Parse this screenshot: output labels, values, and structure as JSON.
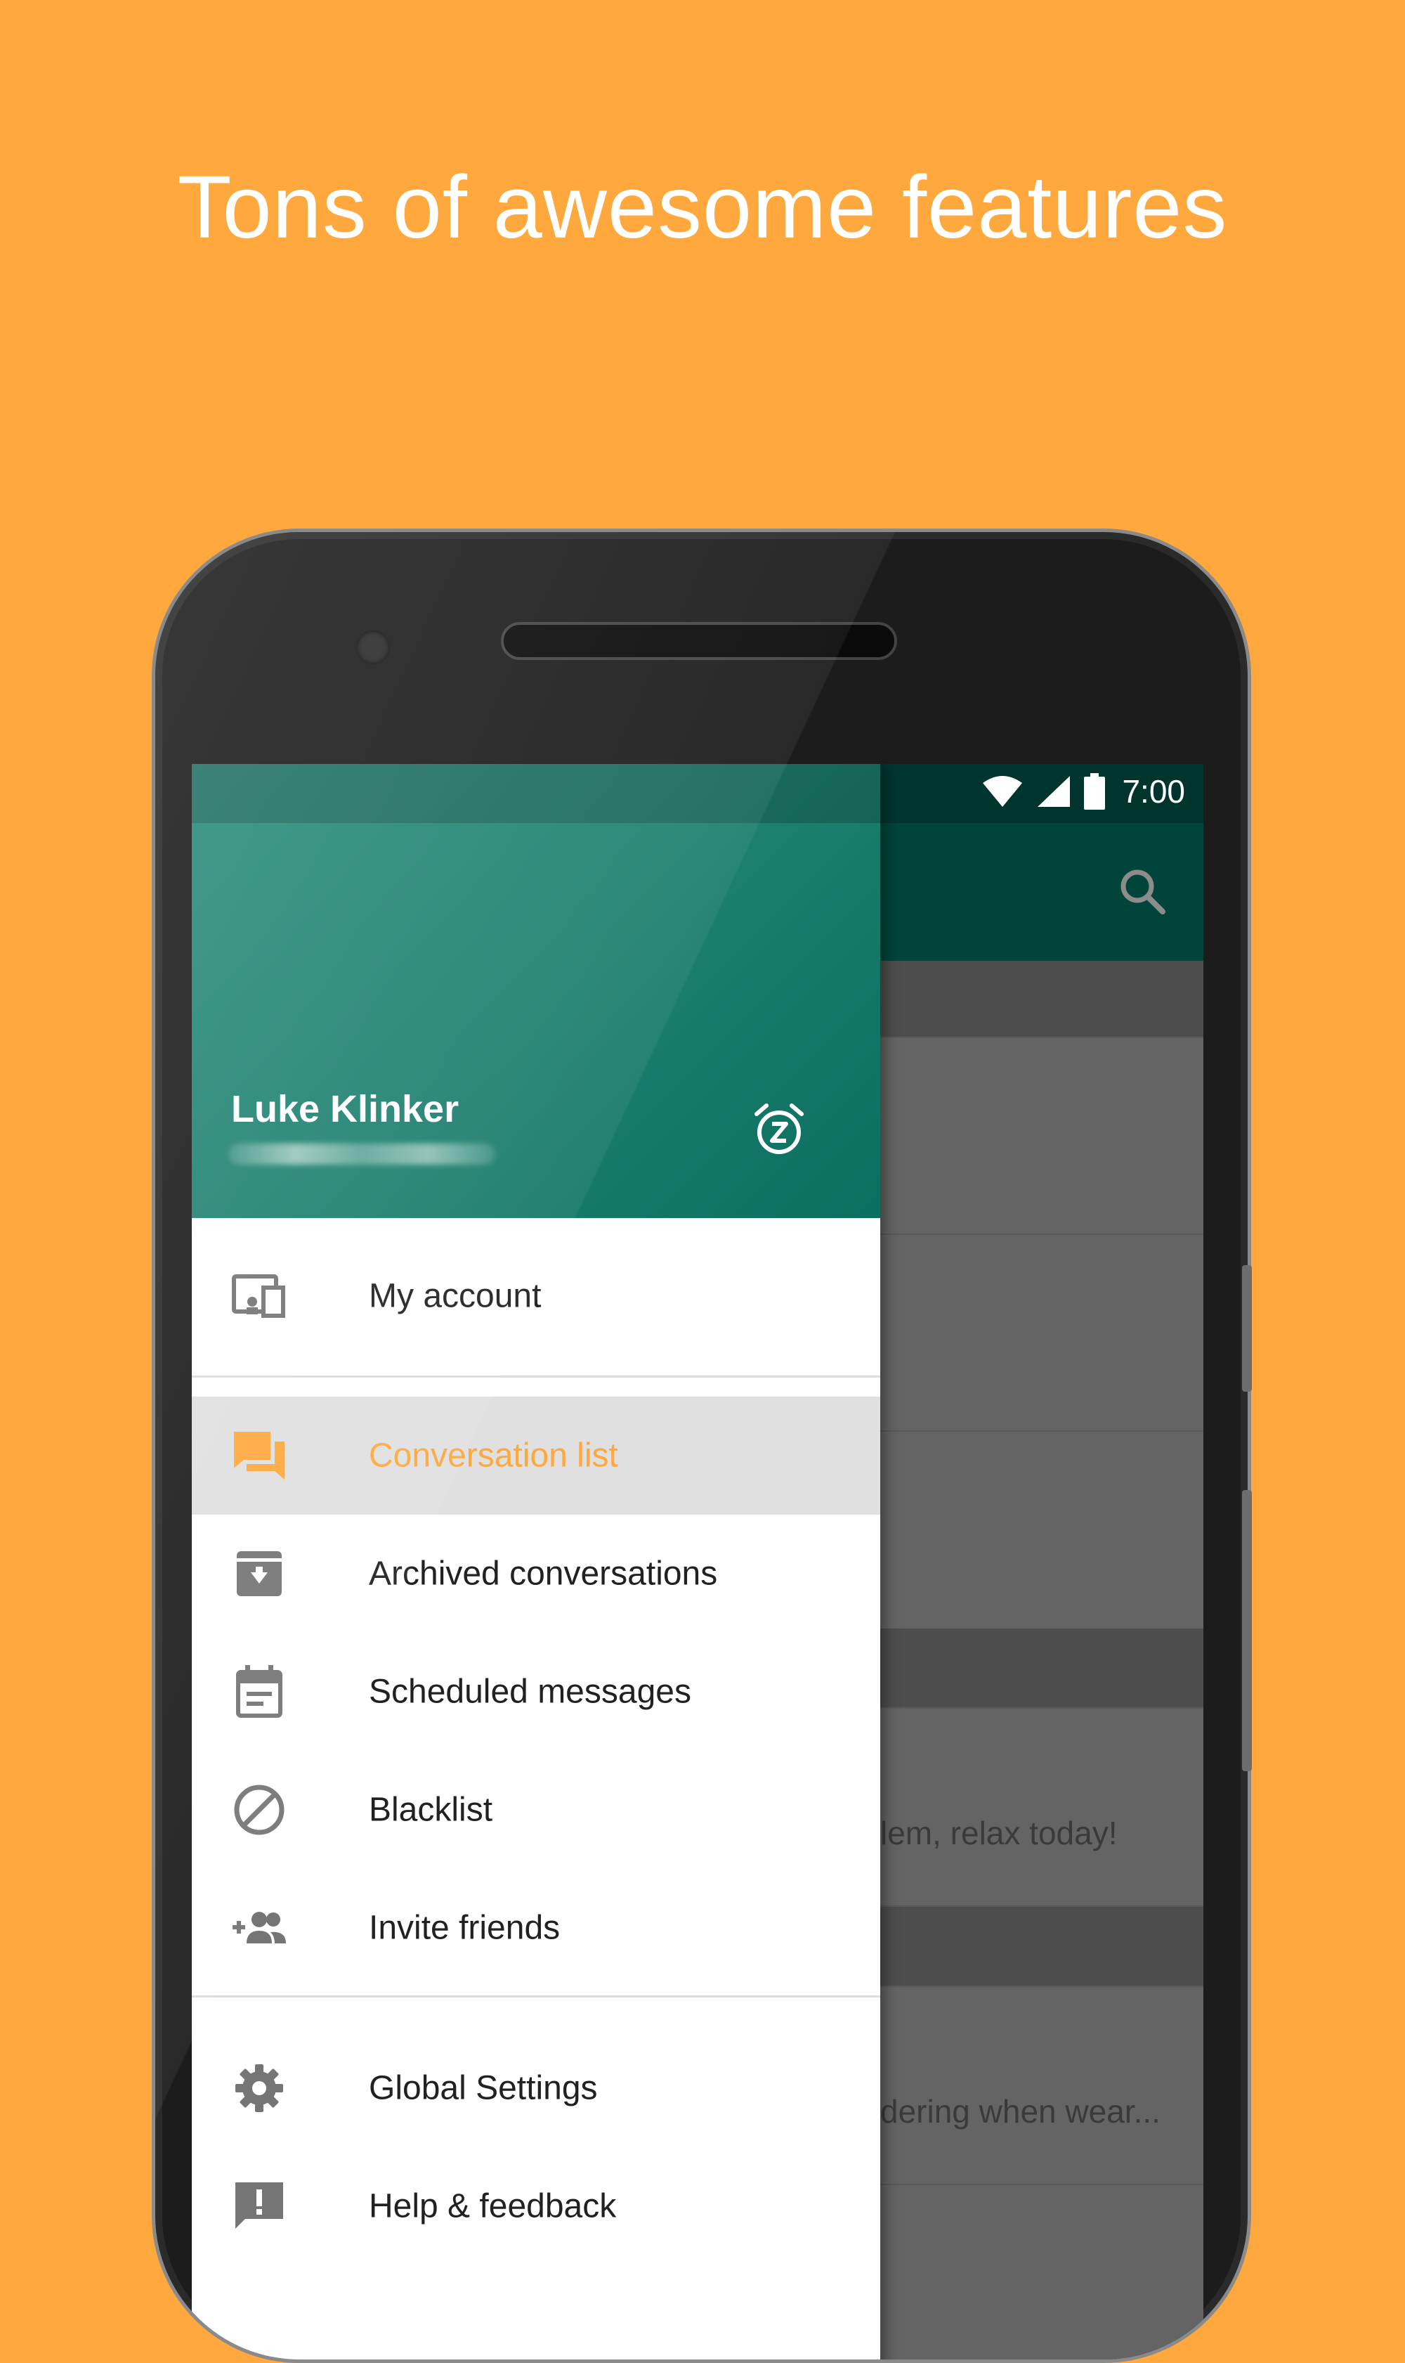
{
  "headline": "Tons of awesome features",
  "colors": {
    "background": "#FFA83E",
    "accent": "#FFA83E",
    "drawer_header": "#1f8170",
    "app_bar": "#00443a"
  },
  "status_bar": {
    "time": "7:00",
    "icons": [
      "wifi-icon",
      "signal-icon",
      "battery-icon"
    ]
  },
  "drawer": {
    "user_name": "Luke Klinker",
    "account_item": {
      "label": "My account",
      "icon": "account-devices-icon"
    },
    "primary_items": [
      {
        "label": "Conversation list",
        "icon": "forum-icon",
        "active": true
      },
      {
        "label": "Archived conversations",
        "icon": "archive-icon",
        "active": false
      },
      {
        "label": "Scheduled messages",
        "icon": "calendar-icon",
        "active": false
      },
      {
        "label": "Blacklist",
        "icon": "block-icon",
        "active": false
      },
      {
        "label": "Invite friends",
        "icon": "group-add-icon",
        "active": false
      }
    ],
    "secondary_items": [
      {
        "label": "Global Settings",
        "icon": "settings-icon"
      },
      {
        "label": "Help & feedback",
        "icon": "feedback-icon"
      }
    ]
  },
  "background_list": {
    "snippets": [
      "lem, relax today!",
      "dering when wear..."
    ]
  }
}
